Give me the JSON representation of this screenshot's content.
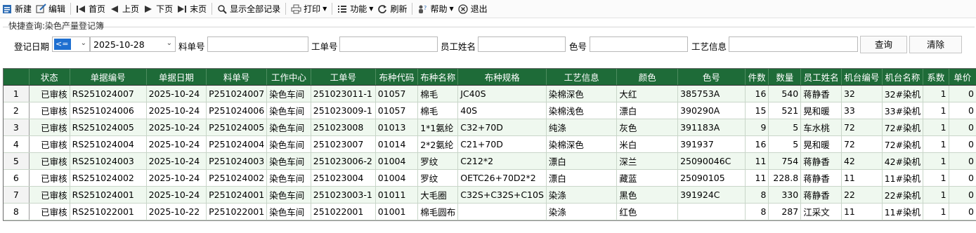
{
  "toolbar": {
    "new": "新建",
    "edit": "编辑",
    "first": "首页",
    "prev": "上页",
    "next": "下页",
    "last": "末页",
    "show_all": "显示全部记录",
    "print": "打印",
    "functions": "功能",
    "refresh": "刷新",
    "help": "帮助",
    "exit": "退出"
  },
  "quick_search": {
    "title": "快捷查询:染色产量登记簿",
    "date_label": "登记日期",
    "op_value": "<=",
    "date_value": "2025-10-28",
    "material_no_label": "料单号",
    "material_no_value": "",
    "work_order_label": "工单号",
    "work_order_value": "",
    "employee_label": "员工姓名",
    "employee_value": "",
    "color_no_label": "色号",
    "color_no_value": "",
    "process_label": "工艺信息",
    "process_value": "",
    "search_button": "查询",
    "clear_button": "清除"
  },
  "grid": {
    "columns": [
      "状态",
      "单据编号",
      "单据日期",
      "料单号",
      "工作中心",
      "工单号",
      "布种代码",
      "布种名称",
      "布种规格",
      "工艺信息",
      "颜色",
      "色号",
      "件数",
      "数量",
      "员工姓名",
      "机台编号",
      "机台名称",
      "系数",
      "单价"
    ],
    "rows": [
      {
        "n": "1",
        "c": [
          "已审核",
          "RS251024007",
          "2025-10-24",
          "P251024007",
          "染色车间",
          "251023011-1",
          "01057",
          "棉毛",
          "JC40S",
          "染棉深色",
          "大红",
          "385753A",
          "16",
          "540",
          "蒋静香",
          "32",
          "32#染机",
          "1",
          "0"
        ]
      },
      {
        "n": "2",
        "c": [
          "已审核",
          "RS251024006",
          "2025-10-24",
          "P251024006",
          "染色车间",
          "251023009-1",
          "01057",
          "棉毛",
          "40S",
          "染棉浅色",
          "漂白",
          "390290A",
          "15",
          "521",
          "晃和暖",
          "33",
          "33#染机",
          "1",
          "0"
        ]
      },
      {
        "n": "3",
        "c": [
          "已审核",
          "RS251024005",
          "2025-10-24",
          "P251024005",
          "染色车间",
          "251023008",
          "01013",
          "1*1氨纶",
          "C32+70D",
          "纯涤",
          "灰色",
          "391183A",
          "9",
          "5",
          "车水桃",
          "72",
          "72#染机",
          "1",
          "0"
        ]
      },
      {
        "n": "4",
        "c": [
          "已审核",
          "RS251024004",
          "2025-10-24",
          "P251024004",
          "染色车间",
          "251023007",
          "01014",
          "2*2氨纶",
          "C21+70D",
          "染棉深色",
          "米白",
          "391937",
          "16",
          "5",
          "晃和暖",
          "72",
          "72#染机",
          "1",
          "0"
        ]
      },
      {
        "n": "5",
        "c": [
          "已审核",
          "RS251024003",
          "2025-10-24",
          "P251024003",
          "染色车间",
          "251023006-2",
          "01004",
          "罗纹",
          "C212*2",
          "漂白",
          "深兰",
          "25090046C",
          "11",
          "754",
          "蒋静香",
          "42",
          "42#染机",
          "1",
          "0"
        ]
      },
      {
        "n": "6",
        "c": [
          "已审核",
          "RS251024002",
          "2025-10-24",
          "P251024002",
          "染色车间",
          "251023004",
          "01004",
          "罗纹",
          "OETC26+70D2*2",
          "漂白",
          "藏蓝",
          "25090105",
          "11",
          "228.8",
          "蒋静香",
          "11",
          "11#染机",
          "1",
          "0"
        ]
      },
      {
        "n": "7",
        "c": [
          "已审核",
          "RS251024001",
          "2025-10-24",
          "P251024001",
          "染色车间",
          "251023003-1",
          "01011",
          "大毛圈",
          "C32S+C32S+C10S",
          "染涤",
          "黑色",
          "391924C",
          "8",
          "330",
          "蒋静香",
          "22",
          "22#染机",
          "1",
          "0"
        ]
      },
      {
        "n": "8",
        "c": [
          "已审核",
          "RS251022001",
          "2025-10-22",
          "P251022001",
          "染色车间",
          "251022001",
          "01001",
          "棉毛圆布",
          "",
          "染涤",
          "红色",
          "",
          "8",
          "287",
          "江采文",
          "11",
          "11#染机",
          "1",
          "0"
        ]
      }
    ]
  },
  "colors": {
    "header_bg": "#1e6b38",
    "row_alt": "#eff8ef",
    "accent": "#1e6fd0"
  }
}
